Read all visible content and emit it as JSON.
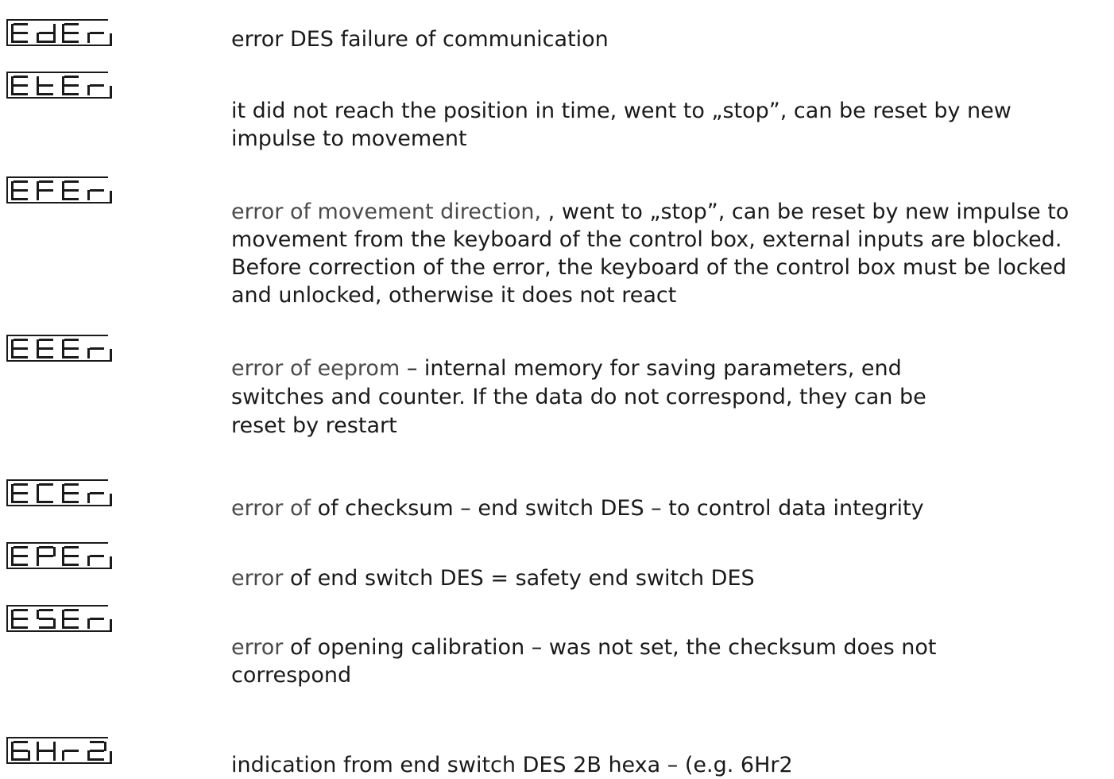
{
  "entries": [
    {
      "code": "EdEr",
      "glyphs": [
        "E",
        "d",
        "E",
        "r"
      ],
      "lead": "",
      "text": "error DES failure of communication"
    },
    {
      "code": "EtEr",
      "glyphs": [
        "E",
        "t",
        "E",
        "r"
      ],
      "lead": "",
      "text": "it did not reach the position in time, went to „stop”, can be reset by new impulse to movement"
    },
    {
      "code": "EFEr",
      "glyphs": [
        "E",
        "F",
        "E",
        "r"
      ],
      "lead": "error of movement direction, ",
      "text": ", went to „stop”, can be reset by new impulse to movement from the keyboard of the control box, external inputs are blocked. Before correction of the error, the keyboard of the control box must be locked and unlocked, otherwise it does not react"
    },
    {
      "code": "EEEr",
      "glyphs": [
        "E",
        "E",
        "E",
        "r"
      ],
      "lead": "error of eeprom",
      "text": " – internal memory for saving parameters, end switches and counter. If the data do not correspond, they can be reset by restart"
    },
    {
      "code": "ECEr",
      "glyphs": [
        "E",
        "C",
        "E",
        "r"
      ],
      "lead": "error of",
      "text": " of checksum – end switch DES – to control data integrity"
    },
    {
      "code": "EPEr",
      "glyphs": [
        "E",
        "P",
        "E",
        "r"
      ],
      "lead": "error",
      "text": " of end switch DES = safety end switch DES"
    },
    {
      "code": "ESEr",
      "glyphs": [
        "E",
        "S",
        "E",
        "r"
      ],
      "lead": "error",
      "text": " of opening calibration – was not set, the checksum does not correspond"
    },
    {
      "code": "6Hr2",
      "glyphs": [
        "6",
        "H",
        "r",
        "2"
      ],
      "lead": "",
      "text": "indication from end switch DES 2B hexa – (e.g. 6Hr2"
    }
  ]
}
